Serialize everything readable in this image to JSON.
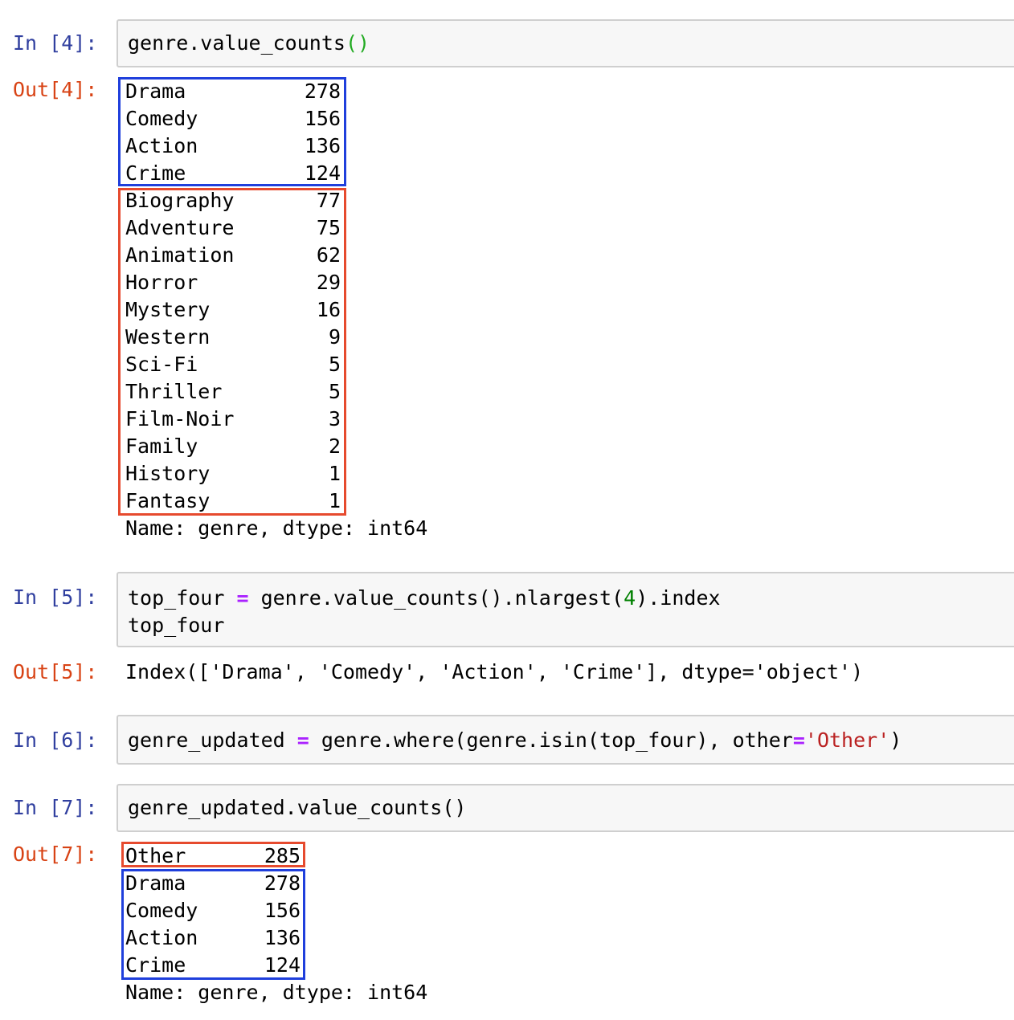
{
  "cells": {
    "c4": {
      "in_prompt": "In [4]:",
      "code": {
        "a": "genre.value_counts",
        "b": "()"
      },
      "out_prompt": "Out[4]:",
      "rows": [
        {
          "label": "Drama",
          "value": "278"
        },
        {
          "label": "Comedy",
          "value": "156"
        },
        {
          "label": "Action",
          "value": "136"
        },
        {
          "label": "Crime",
          "value": "124"
        },
        {
          "label": "Biography",
          "value": "77"
        },
        {
          "label": "Adventure",
          "value": "75"
        },
        {
          "label": "Animation",
          "value": "62"
        },
        {
          "label": "Horror",
          "value": "29"
        },
        {
          "label": "Mystery",
          "value": "16"
        },
        {
          "label": "Western",
          "value": "9"
        },
        {
          "label": "Sci-Fi",
          "value": "5"
        },
        {
          "label": "Thriller",
          "value": "5"
        },
        {
          "label": "Film-Noir",
          "value": "3"
        },
        {
          "label": "Family",
          "value": "2"
        },
        {
          "label": "History",
          "value": "1"
        },
        {
          "label": "Fantasy",
          "value": "1"
        }
      ],
      "footer": "Name: genre, dtype: int64"
    },
    "c5": {
      "in_prompt": "In [5]:",
      "code": {
        "a": "top_four ",
        "op": "=",
        "b": " genre.value_counts().nlargest(",
        "num": "4",
        "c": ").index",
        "line2": "top_four"
      },
      "out_prompt": "Out[5]:",
      "output": "Index(['Drama', 'Comedy', 'Action', 'Crime'], dtype='object')"
    },
    "c6": {
      "in_prompt": "In [6]:",
      "code": {
        "a": "genre_updated ",
        "op": "=",
        "b": " genre.where(genre.isin(top_four), other",
        "op2": "=",
        "str": "'Other'",
        "c": ")"
      }
    },
    "c7": {
      "in_prompt": "In [7]:",
      "code": {
        "a": "genre_updated.value_counts()"
      },
      "out_prompt": "Out[7]:",
      "rows": [
        {
          "label": "Other",
          "value": "285"
        },
        {
          "label": "Drama",
          "value": "278"
        },
        {
          "label": "Comedy",
          "value": "156"
        },
        {
          "label": "Action",
          "value": "136"
        },
        {
          "label": "Crime",
          "value": "124"
        }
      ],
      "footer": "Name: genre, dtype: int64"
    }
  },
  "colors": {
    "in_prompt": "#303f9f",
    "out_prompt": "#d84315",
    "highlight_blue": "#1f3fdc",
    "highlight_red": "#e64a2e"
  }
}
